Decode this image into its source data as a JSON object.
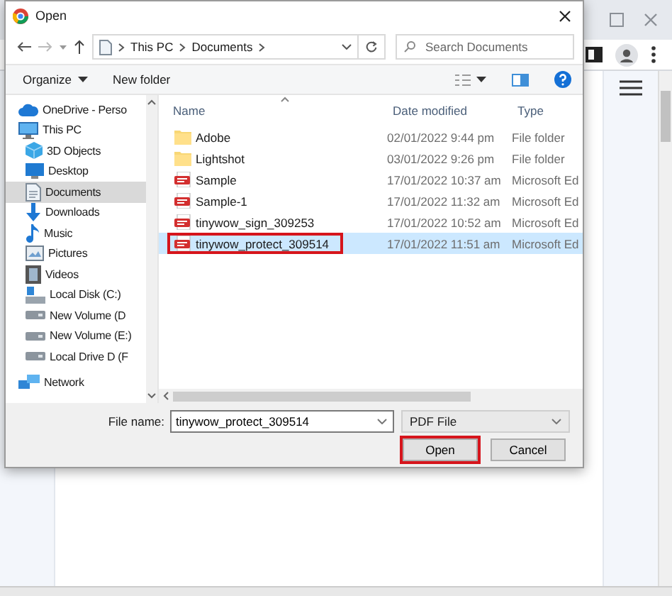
{
  "dialog": {
    "title": "Open",
    "address": {
      "path": [
        "This PC",
        "Documents"
      ]
    },
    "search": {
      "placeholder": "Search Documents"
    },
    "commands": [
      "Organize",
      "New folder"
    ],
    "nav": [
      {
        "label": "OneDrive - Perso",
        "kind": "cloud",
        "selected": false
      },
      {
        "label": "This PC",
        "kind": "pc",
        "selected": false,
        "children": [
          {
            "label": "3D Objects",
            "kind": "cube",
            "selected": false
          },
          {
            "label": "Desktop",
            "kind": "desktop",
            "selected": false
          },
          {
            "label": "Documents",
            "kind": "document",
            "selected": true
          },
          {
            "label": "Downloads",
            "kind": "download",
            "selected": false
          },
          {
            "label": "Music",
            "kind": "music",
            "selected": false
          },
          {
            "label": "Pictures",
            "kind": "pictures",
            "selected": false
          },
          {
            "label": "Videos",
            "kind": "video",
            "selected": false
          },
          {
            "label": "Local Disk (C:)",
            "kind": "system-drive",
            "selected": false
          },
          {
            "label": "New Volume (D",
            "kind": "drive",
            "selected": false
          },
          {
            "label": "New Volume (E:)",
            "kind": "drive",
            "selected": false
          },
          {
            "label": "Local Drive D (F",
            "kind": "drive",
            "selected": false
          }
        ]
      },
      {
        "label": "Network",
        "kind": "network",
        "selected": false
      }
    ],
    "columns": [
      "Name",
      "Date modified",
      "Type"
    ],
    "files": [
      {
        "name": "Adobe",
        "date": "02/01/2022 9:44 pm",
        "type": "File folder",
        "kind": "folder",
        "selected": false,
        "highlighted": false
      },
      {
        "name": "Lightshot",
        "date": "03/01/2022 9:26 pm",
        "type": "File folder",
        "kind": "folder",
        "selected": false,
        "highlighted": false
      },
      {
        "name": "Sample",
        "date": "17/01/2022 10:37 am",
        "type": "Microsoft Ed",
        "kind": "pdf",
        "selected": false,
        "highlighted": false
      },
      {
        "name": "Sample-1",
        "date": "17/01/2022 11:32 am",
        "type": "Microsoft Ed",
        "kind": "pdf",
        "selected": false,
        "highlighted": false
      },
      {
        "name": "tinywow_sign_309253",
        "date": "17/01/2022 10:52 am",
        "type": "Microsoft Ed",
        "kind": "pdf",
        "selected": false,
        "highlighted": false
      },
      {
        "name": "tinywow_protect_309514",
        "date": "17/01/2022 11:51 am",
        "type": "Microsoft Ed",
        "kind": "pdf",
        "selected": true,
        "highlighted": true
      }
    ],
    "file_name": {
      "label": "File name:",
      "value": "tinywow_protect_309514"
    },
    "file_type": "PDF File",
    "buttons": [
      {
        "label": "Open",
        "highlighted": true
      },
      {
        "label": "Cancel",
        "highlighted": false
      }
    ]
  }
}
